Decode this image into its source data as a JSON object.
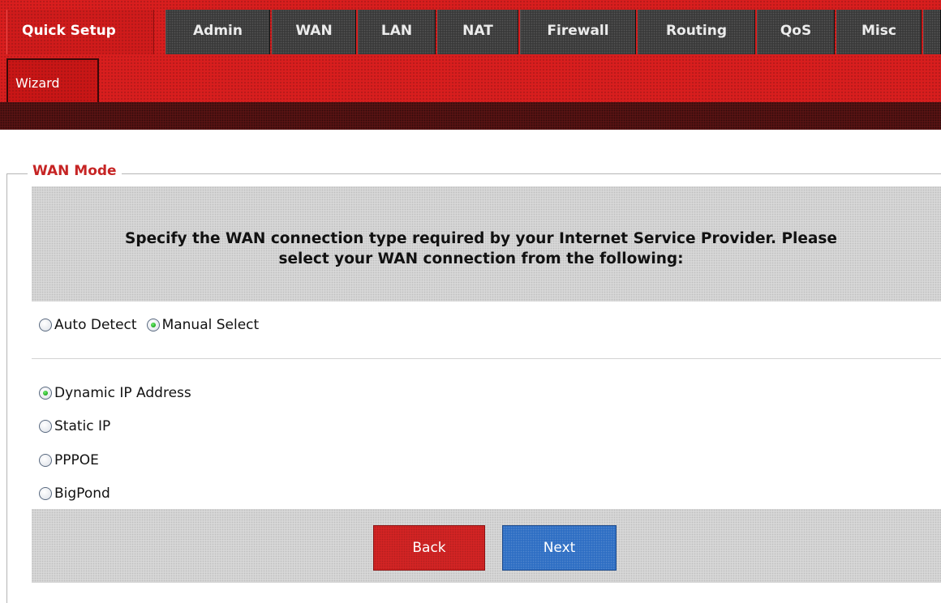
{
  "nav": {
    "tabs": [
      {
        "label": "Quick Setup",
        "active": true
      },
      {
        "label": "Admin",
        "active": false
      },
      {
        "label": "WAN",
        "active": false
      },
      {
        "label": "LAN",
        "active": false
      },
      {
        "label": "NAT",
        "active": false
      },
      {
        "label": "Firewall",
        "active": false
      },
      {
        "label": "Routing",
        "active": false
      },
      {
        "label": "QoS",
        "active": false
      },
      {
        "label": "Misc",
        "active": false
      }
    ],
    "subnav": {
      "label": "Wizard"
    }
  },
  "section": {
    "legend": "WAN Mode",
    "instructions_line1": "Specify the WAN connection type required by your Internet Service Provider. Please",
    "instructions_line2": "select your WAN connection from the following:"
  },
  "detect_mode": {
    "options": [
      {
        "label": "Auto Detect",
        "checked": false
      },
      {
        "label": "Manual Select",
        "checked": true
      }
    ]
  },
  "connection_types": {
    "options": [
      {
        "label": "Dynamic IP Address",
        "checked": true
      },
      {
        "label": "Static IP",
        "checked": false
      },
      {
        "label": "PPPOE",
        "checked": false
      },
      {
        "label": "BigPond",
        "checked": false
      }
    ]
  },
  "actions": {
    "back_label": "Back",
    "next_label": "Next"
  },
  "colors": {
    "header_red": "#d81e1e",
    "tab_dark": "#3a3a3a",
    "legend_red": "#c62424",
    "back_red": "#d22424",
    "next_blue": "#2f6fc4",
    "radio_checked_green": "#22a822"
  }
}
